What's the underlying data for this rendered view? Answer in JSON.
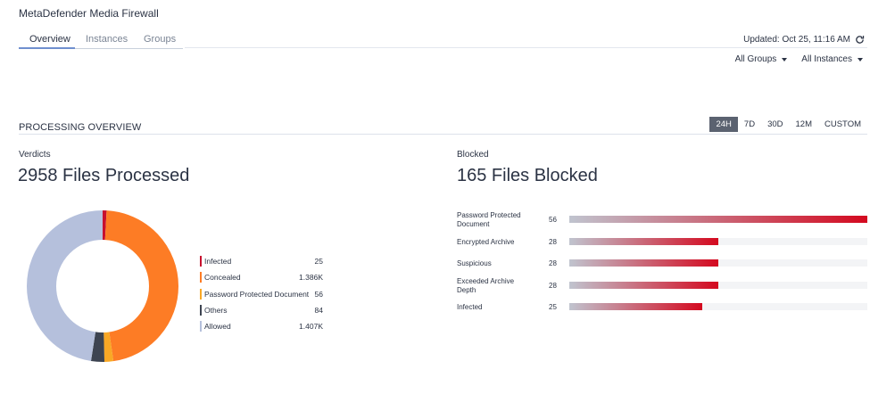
{
  "app": {
    "title": "MetaDefender Media Firewall"
  },
  "tabs": [
    {
      "label": "Overview",
      "active": true
    },
    {
      "label": "Instances",
      "active": false
    },
    {
      "label": "Groups",
      "active": false
    }
  ],
  "header": {
    "updated": "Updated: Oct 25, 11:16 AM",
    "refresh_icon": "refresh-icon"
  },
  "filters": {
    "groups": "All Groups",
    "instances": "All Instances"
  },
  "section": {
    "title": "PROCESSING OVERVIEW",
    "ranges": [
      {
        "label": "24H",
        "active": true
      },
      {
        "label": "7D",
        "active": false
      },
      {
        "label": "30D",
        "active": false
      },
      {
        "label": "12M",
        "active": false
      },
      {
        "label": "CUSTOM",
        "active": false
      }
    ]
  },
  "verdicts": {
    "label": "Verdicts",
    "headline": "2958 Files Processed",
    "items": [
      {
        "name": "Infected",
        "value": "25",
        "count": 25,
        "color": "#c8102e"
      },
      {
        "name": "Concealed",
        "value": "1.386K",
        "count": 1386,
        "color": "#fd7c25"
      },
      {
        "name": "Password Protected Document",
        "value": "56",
        "count": 56,
        "color": "#f9a825"
      },
      {
        "name": "Others",
        "value": "84",
        "count": 84,
        "color": "#3d4451"
      },
      {
        "name": "Allowed",
        "value": "1.407K",
        "count": 1407,
        "color": "#b5c0dc"
      }
    ]
  },
  "blocked": {
    "label": "Blocked",
    "headline": "165 Files Blocked",
    "max": 56,
    "items": [
      {
        "name": "Password Protected Document",
        "value": "56",
        "count": 56
      },
      {
        "name": "Encrypted Archive",
        "value": "28",
        "count": 28
      },
      {
        "name": "Suspicious",
        "value": "28",
        "count": 28
      },
      {
        "name": "Exceeded Archive Depth",
        "value": "28",
        "count": 28
      },
      {
        "name": "Infected",
        "value": "25",
        "count": 25
      }
    ]
  }
}
